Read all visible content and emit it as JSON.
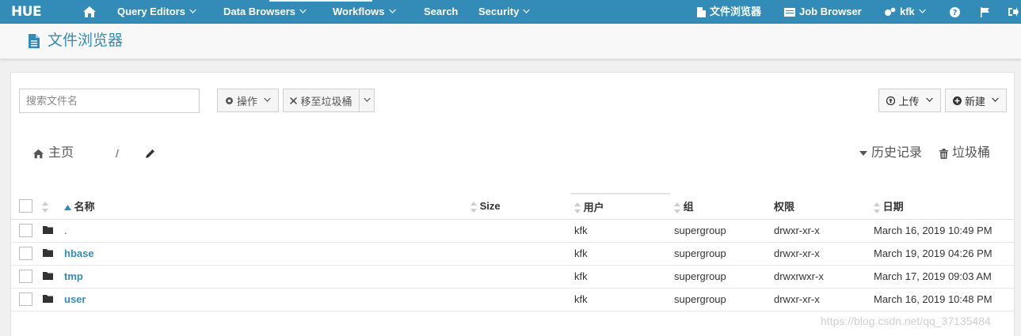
{
  "navbar": {
    "logo": "HUE",
    "items": [
      "Query Editors",
      "Data Browsers",
      "Workflows",
      "Search",
      "Security"
    ],
    "file_browser": "文件浏览器",
    "job_browser": "Job Browser",
    "user": "kfk"
  },
  "page": {
    "title": "文件浏览器"
  },
  "toolbar": {
    "search_placeholder": "搜索文件名",
    "actions": "操作",
    "move_to_trash": "移至垃圾桶",
    "upload": "上传",
    "new": "新建"
  },
  "breadcrumb": {
    "home": "主页",
    "separator": "/"
  },
  "links": {
    "history": "历史记录",
    "trash": "垃圾桶"
  },
  "table": {
    "headers": [
      "名称",
      "Size",
      "用户",
      "组",
      "权限",
      "日期"
    ],
    "rows": [
      {
        "name": ".",
        "size": "",
        "user": "kfk",
        "group": "supergroup",
        "perm": "drwxr-xr-x",
        "date": "March 16, 2019 10:49 PM"
      },
      {
        "name": "hbase",
        "size": "",
        "user": "kfk",
        "group": "supergroup",
        "perm": "drwxr-xr-x",
        "date": "March 19, 2019 04:26 PM"
      },
      {
        "name": "tmp",
        "size": "",
        "user": "kfk",
        "group": "supergroup",
        "perm": "drwxrwxr-x",
        "date": "March 17, 2019 09:03 AM"
      },
      {
        "name": "user",
        "size": "",
        "user": "kfk",
        "group": "supergroup",
        "perm": "drwxr-xr-x",
        "date": "March 16, 2019 10:48 PM"
      }
    ]
  },
  "watermark": "https://blog.csdn.net/qq_37135484",
  "colors": {
    "brand": "#338bb8",
    "link": "#338bb8"
  }
}
